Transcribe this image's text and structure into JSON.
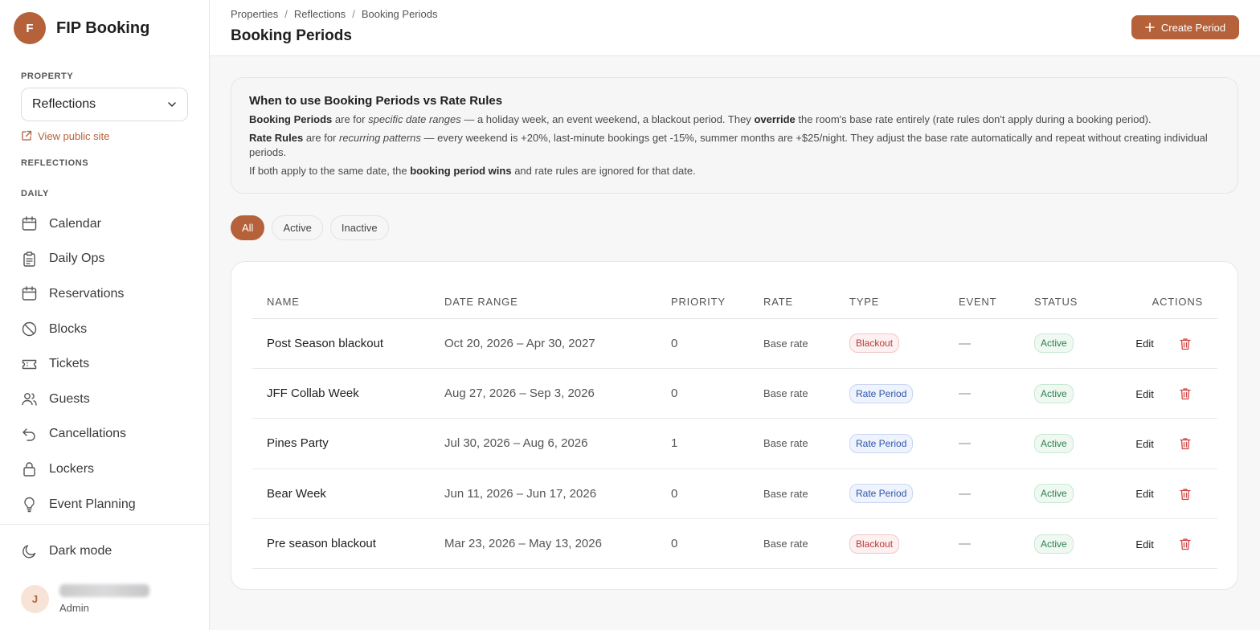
{
  "brand": {
    "initial": "F",
    "title": "FIP Booking"
  },
  "sidebar": {
    "property_label": "PROPERTY",
    "property_value": "Reflections",
    "public_link": "View public site",
    "reflections_label": "REFLECTIONS",
    "daily_label": "DAILY",
    "items": [
      {
        "label": "Calendar",
        "icon": "calendar-icon"
      },
      {
        "label": "Daily Ops",
        "icon": "clipboard-icon"
      },
      {
        "label": "Reservations",
        "icon": "calendar-icon"
      },
      {
        "label": "Blocks",
        "icon": "ban-icon"
      },
      {
        "label": "Tickets",
        "icon": "ticket-icon"
      },
      {
        "label": "Guests",
        "icon": "users-icon"
      },
      {
        "label": "Cancellations",
        "icon": "undo-icon"
      },
      {
        "label": "Lockers",
        "icon": "lock-icon"
      },
      {
        "label": "Event Planning",
        "icon": "lightbulb-icon"
      }
    ],
    "dark_mode": "Dark mode",
    "user": {
      "initial": "J",
      "role": "Admin"
    }
  },
  "header": {
    "breadcrumbs": [
      "Properties",
      "Reflections",
      "Booking Periods"
    ],
    "title": "Booking Periods",
    "create_label": "Create Period"
  },
  "info": {
    "title": "When to use Booking Periods vs Rate Rules",
    "p1": {
      "a": "Booking Periods",
      "b": " are for ",
      "c": "specific date ranges",
      "d": " — a holiday week, an event weekend, a blackout period. They ",
      "e": "override",
      "f": " the room's base rate entirely (rate rules don't apply during a booking period)."
    },
    "p2": {
      "a": "Rate Rules",
      "b": " are for ",
      "c": "recurring patterns",
      "d": " — every weekend is +20%, last-minute bookings get -15%, summer months are +$25/night. They adjust the base rate automatically and repeat without creating individual periods."
    },
    "p3": {
      "a": "If both apply to the same date, the ",
      "b": "booking period wins",
      "c": " and rate rules are ignored for that date."
    }
  },
  "filters": [
    "All",
    "Active",
    "Inactive"
  ],
  "table": {
    "headers": [
      "NAME",
      "DATE RANGE",
      "PRIORITY",
      "RATE",
      "TYPE",
      "EVENT",
      "STATUS",
      "ACTIONS"
    ],
    "edit_label": "Edit",
    "rows": [
      {
        "name": "Post Season blackout",
        "dates": "Oct 20, 2026 – Apr 30, 2027",
        "priority": "0",
        "rate": "Base rate",
        "type": "Blackout",
        "event": "—",
        "status": "Active"
      },
      {
        "name": "JFF Collab Week",
        "dates": "Aug 27, 2026 – Sep 3, 2026",
        "priority": "0",
        "rate": "Base rate",
        "type": "Rate Period",
        "event": "—",
        "status": "Active"
      },
      {
        "name": "Pines Party",
        "dates": "Jul 30, 2026 – Aug 6, 2026",
        "priority": "1",
        "rate": "Base rate",
        "type": "Rate Period",
        "event": "—",
        "status": "Active"
      },
      {
        "name": "Bear Week",
        "dates": "Jun 11, 2026 – Jun 17, 2026",
        "priority": "0",
        "rate": "Base rate",
        "type": "Rate Period",
        "event": "—",
        "status": "Active"
      },
      {
        "name": "Pre season blackout",
        "dates": "Mar 23, 2026 – May 13, 2026",
        "priority": "0",
        "rate": "Base rate",
        "type": "Blackout",
        "event": "—",
        "status": "Active"
      }
    ]
  },
  "colors": {
    "accent": "#b5613a",
    "blackout": "#b93a3a",
    "rate_period": "#2f56a8",
    "active": "#2e7d4d"
  }
}
